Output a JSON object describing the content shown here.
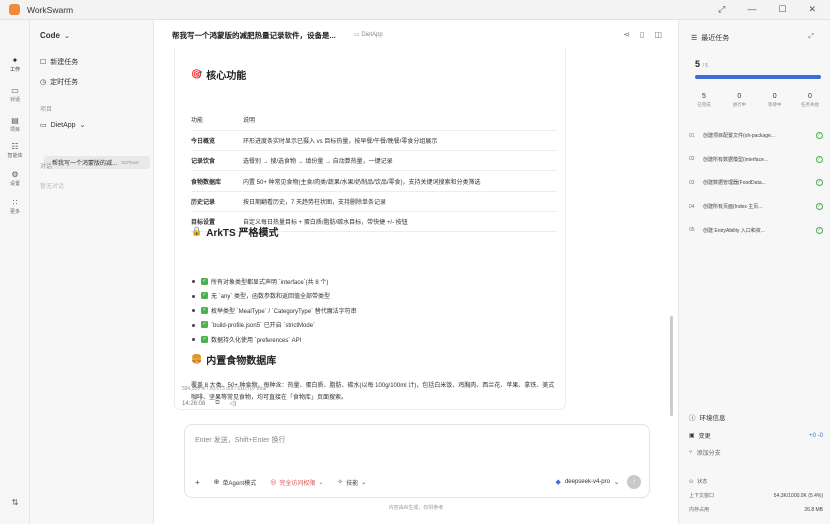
{
  "app": {
    "name": "WorkSwarm",
    "window_controls": [
      "⤢",
      "—",
      "☐",
      "✕"
    ]
  },
  "rail": [
    {
      "icon": "sparkle-icon",
      "glyph": "✦",
      "label": "工作",
      "active": true
    },
    {
      "icon": "window-icon",
      "glyph": "▭",
      "label": "对话",
      "active": false
    },
    {
      "icon": "card-icon",
      "glyph": "▤",
      "label": "项目",
      "active": false
    },
    {
      "icon": "people-icon",
      "glyph": "☷",
      "label": "智能体",
      "active": false
    },
    {
      "icon": "gear-icon",
      "glyph": "⚙",
      "label": "设置",
      "active": false
    },
    {
      "icon": "grid-icon",
      "glyph": "∷",
      "label": "更多",
      "active": false
    }
  ],
  "sidebar": {
    "title": "Code",
    "new_task": "新建任务",
    "scheduled": "定时任务",
    "projects_label": "项目",
    "project_name": "DietApp",
    "active_chat": "帮我写一个鸿蒙版的减...",
    "active_chat_badge": "SDPlanE",
    "chats_label": "对话",
    "chats_empty": "暂无对话"
  },
  "main": {
    "title": "帮我写一个鸿蒙版的减肥热量记录软件，设备是...",
    "project_tag": "DietApp",
    "sections": {
      "core": "核心功能",
      "arkts": "ArkTS 严格模式",
      "foods": "内置食物数据库"
    },
    "table": {
      "headers": [
        "功能",
        "说明"
      ],
      "rows": [
        [
          "今日概览",
          "环形进度条实时显示已摄入 vs 目标热量，按早餐/午餐/晚餐/零食分组展示"
        ],
        [
          "记录饮食",
          "选餐别 → 搜/选食物 → 填份量 → 自动算热量，一键记录"
        ],
        [
          "食物数据库",
          "内置 50+ 种常见食物(主食/肉类/蔬果/水果/奶制品/饮品/零食)，支持关键词搜索和分类筛选"
        ],
        [
          "历史记录",
          "按日期翻看历史，7 天趋势柱状图，支持删除单条记录"
        ],
        [
          "目标设置",
          "自定义每日热量目标 + 蛋白质/脂肪/碳水目标，带快捷 +/- 按钮"
        ]
      ]
    },
    "checklist": [
      "所有对象类型都显式声明 `interface`(共 8 个)",
      "无 `any` 类型，函数参数和返回值全部带类型",
      "枚举类型 `MealType` / `CategoryType` 替代魔法字符串",
      "`build-profile.json5` 已开启 `strictMode`",
      "数据持久化使用 `preferences` API"
    ],
    "foods_paragraph": "覆盖 8 大类、50+ 种食物，每种含：热量、蛋白质、脂肪、碳水(以每 100g/100ml 计)，包括白米饭、鸡胸肉、西兰花、苹果、拿铁、美式咖啡、坚果等常见食物，均可直接在「食物库」页面搜索。",
    "token_stats": "584,535 in / 26,173 out / 610,707 total",
    "time": "14:26:08"
  },
  "input": {
    "placeholder": "Enter 发送，Shift+Enter 换行",
    "agent_mode": "单Agent模式",
    "permission": "完全访问权限",
    "skills": "技能",
    "model": "deepseek-v4-pro",
    "disclaimer": "内容由AI生成，仅供参考"
  },
  "right": {
    "title": "最近任务",
    "done_count": "5",
    "total_count": "/ 5",
    "progress": 1.0,
    "stats": [
      {
        "n": "5",
        "l": "已完成"
      },
      {
        "n": "0",
        "l": "进行中"
      },
      {
        "n": "0",
        "l": "等待中"
      },
      {
        "n": "0",
        "l": "任务失败"
      }
    ],
    "tasks": [
      {
        "num": "01",
        "text": "创建项目配置文件(oh-package..."
      },
      {
        "num": "02",
        "text": "创建所有数据模型(interface..."
      },
      {
        "num": "03",
        "text": "创建数据管理器(FoodData..."
      },
      {
        "num": "04",
        "text": "创建所有页面(Index 主页..."
      },
      {
        "num": "05",
        "text": "创建 EntryAbility 入口和资..."
      }
    ],
    "env_title": "环境信息",
    "env_rows": [
      {
        "k": "变更",
        "v": "+0 -0"
      },
      {
        "k": "添加分支",
        "v": ""
      }
    ],
    "status_label": "状态",
    "context_label": "上下文窗口",
    "context_value": "54.3K/1000.0K (5.4%)",
    "memory_label": "内存占用",
    "memory_value": "26.8 MB"
  }
}
